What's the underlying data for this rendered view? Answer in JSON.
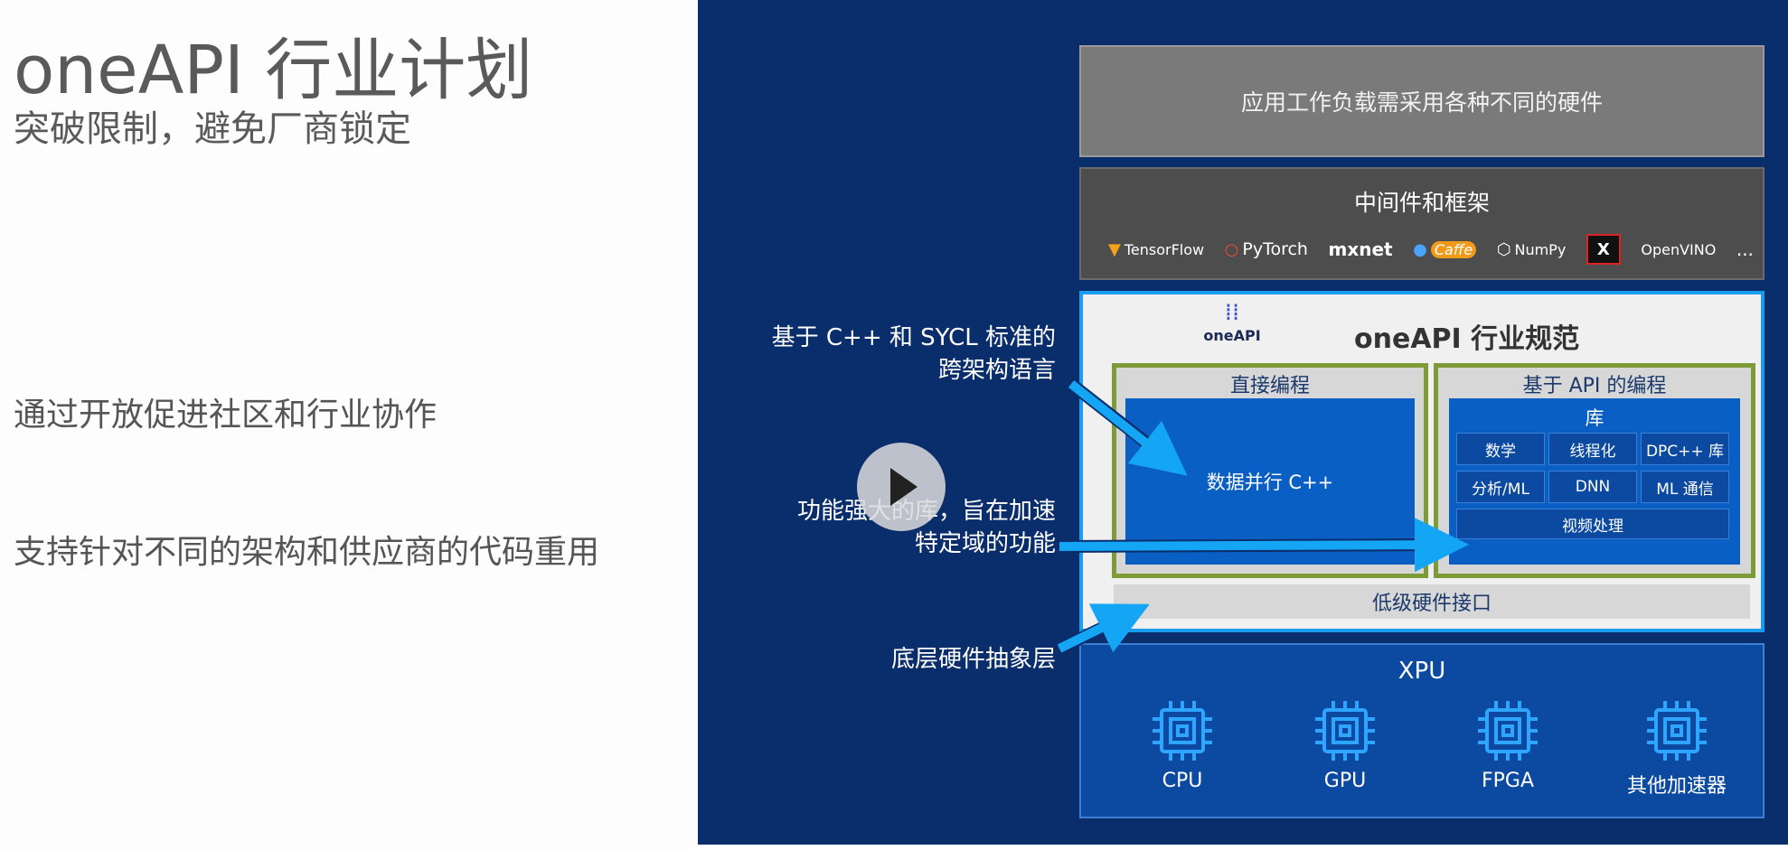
{
  "left": {
    "title": "oneAPI 行业计划",
    "subtitle": "突破限制，避免厂商锁定",
    "bullets": [
      "通过开放促进社区和行业协作",
      "支持针对不同的架构和供应商的代码重用"
    ]
  },
  "stack": {
    "apps": "应用工作负载需采用各种不同的硬件",
    "middleware": {
      "title": "中间件和框架",
      "logos": [
        "TensorFlow",
        "PyTorch",
        "mxnet",
        "Caffe",
        "NumPy",
        "X",
        "OpenVINO",
        "..."
      ]
    },
    "spec": {
      "title": "oneAPI 行业规范",
      "logo_text": "oneAPI",
      "direct": {
        "head": "直接编程",
        "body": "数据并行 C++"
      },
      "api": {
        "head": "基于 API 的编程",
        "lib_title": "库",
        "cells": [
          "数学",
          "线程化",
          "DPC++ 库",
          "分析/ML",
          "DNN",
          "ML 通信",
          "视频处理"
        ]
      },
      "lowlevel": "低级硬件接口"
    },
    "xpu": {
      "title": "XPU",
      "items": [
        "CPU",
        "GPU",
        "FPGA",
        "其他加速器"
      ]
    }
  },
  "annotations": {
    "a1": [
      "基于 C++ 和 SYCL 标准的",
      "跨架构语言"
    ],
    "a2": [
      "功能强大的库，旨在加速",
      "特定域的功能"
    ],
    "a3": [
      "底层硬件抽象层"
    ]
  },
  "colors": {
    "panel": "#0a2d6b",
    "accent": "#1a9cf0",
    "green_border": "#7e9b3a",
    "block_blue": "#0a5fc4"
  },
  "icons": {
    "play": "play-icon",
    "chip": "chip-icon"
  }
}
